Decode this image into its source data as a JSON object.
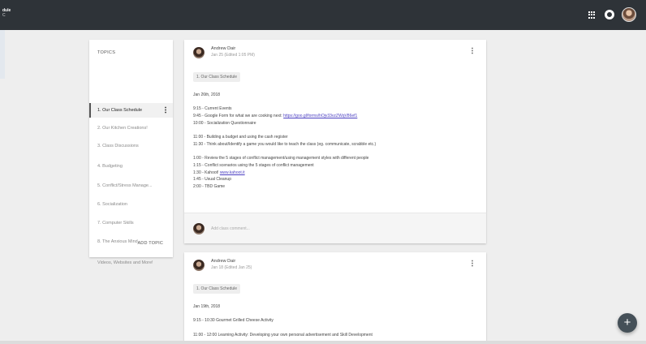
{
  "app": {
    "title": "dule",
    "subtitle": "C"
  },
  "topics": {
    "heading": "TOPICS",
    "items": [
      {
        "label": "1. Our Class Schedule",
        "active": true
      },
      {
        "label": "2. Our Kitchen Creations!"
      },
      {
        "label": "3. Class Discussions"
      },
      {
        "label": "4. Budgeting"
      },
      {
        "label": "5. Conflict/Stress Manage..."
      },
      {
        "label": "6. Socialization"
      },
      {
        "label": "7. Computer Skills"
      },
      {
        "label": "8. The Anxious Mind"
      },
      {
        "label": "Videos, Websites and More!"
      }
    ],
    "add_label": "ADD TOPIC"
  },
  "posts": [
    {
      "author": "Andrew Dair",
      "date": "Jan 25 (Edited 1:05 PM)",
      "topic_chip": "1. Our Class Schedule",
      "title_line": "Jan 26th, 2018",
      "lines": {
        "l1": "9:15 - Current Events",
        "l2_prefix": "9:45 - Google Form for what we are cooking next: ",
        "l2_link": "https://goo.gl/forms/hOjv33vzZWqV86ef1",
        "l3": "10:00 - Socialization Questionnaire",
        "l4": "11:00 - Building a budget and using the cash register",
        "l5": "11:30 - Think about/Identify a game you would like to teach the class (eg. communicate, scrabble etc.)",
        "l6": "1:00 - Review the 5 stages of conflict management/using management styles with different people",
        "l7": "1:15 - Conflict scenarios using the 5 stages of conflict management",
        "l8_prefix": "1:30 - Kahoot! ",
        "l8_link": "www.kahoot.it",
        "l9": "1:45 - Usual Cleanup",
        "l10": "2:00 - TBD Game"
      },
      "comment_placeholder": "Add class comment..."
    },
    {
      "author": "Andrew Dair",
      "date": "Jan 18 (Edited Jan 25)",
      "topic_chip": "1. Our Class Schedule",
      "title_line": "Jan 19th, 2018",
      "lines": {
        "l1": "9:15 - 10:30 Gourmet Grilled Cheese Activity",
        "l2": "11:00 - 12:00 Learning Activity: Developing your own personal advertisement and Skill Development"
      }
    }
  ],
  "fab": {
    "label": "+"
  }
}
